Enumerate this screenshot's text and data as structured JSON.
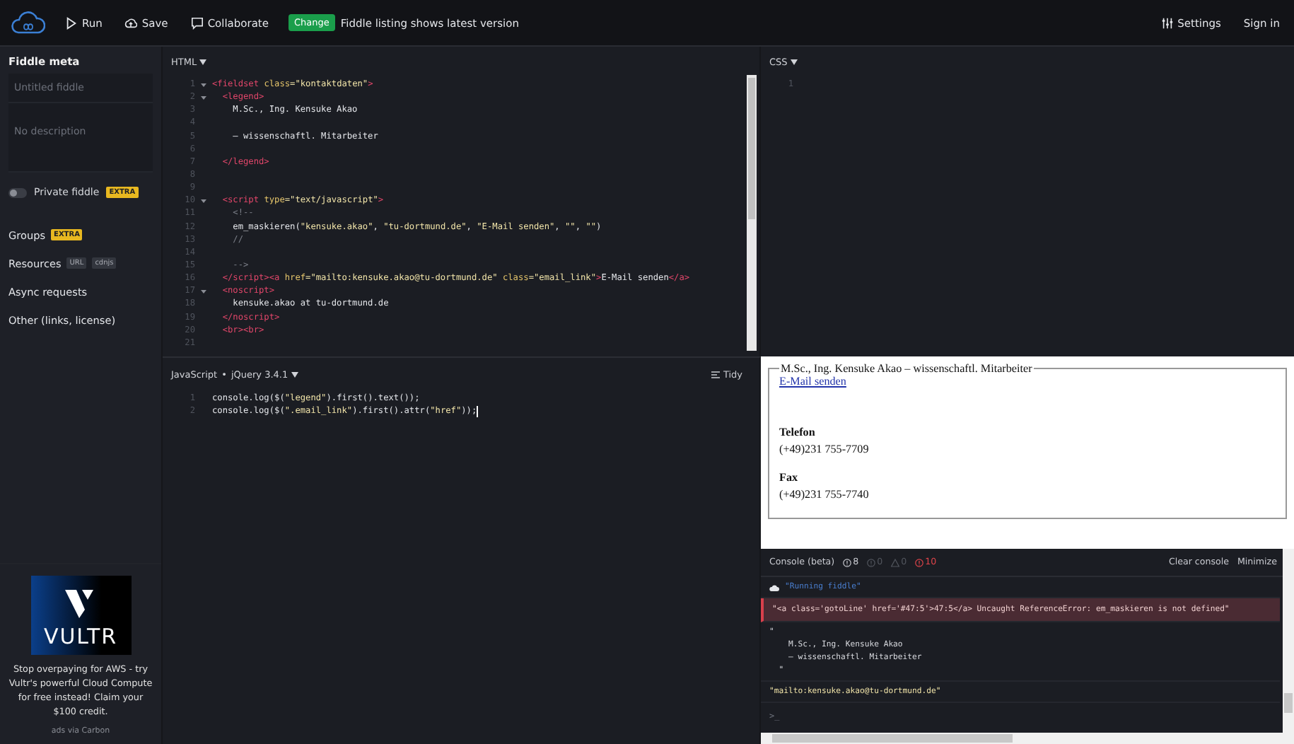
{
  "toolbar": {
    "actions": [
      {
        "label": "Run"
      },
      {
        "label": "Save"
      },
      {
        "label": "Collaborate"
      }
    ],
    "badge": "Change",
    "notice": "Fiddle listing shows latest version",
    "right": [
      {
        "label": "Settings"
      },
      {
        "label": "Sign in"
      }
    ]
  },
  "sidebar": {
    "title": "Fiddle meta",
    "title_field": {
      "placeholder": "Untitled fiddle"
    },
    "description_field": {
      "placeholder": "No description"
    },
    "private_toggle": {
      "label": "Private fiddle",
      "on": false,
      "badge": "EXTRA"
    },
    "items": [
      {
        "label": "Groups",
        "tags": [
          {
            "text": "EXTRA",
            "kind": "extra"
          }
        ]
      },
      {
        "label": "Resources",
        "tags": [
          {
            "text": "URL",
            "kind": "plain"
          },
          {
            "text": "cdnjs",
            "kind": "plain"
          }
        ]
      },
      {
        "label": "Async requests"
      },
      {
        "label": "Other (links, license)"
      }
    ],
    "ad": {
      "logo": "VULTR",
      "text": "Stop overpaying for AWS - try Vultr's powerful Cloud Compute for free instead! Claim your $100 credit.",
      "footer": "ads via Carbon"
    }
  },
  "html_editor": {
    "label": "HTML",
    "lines": [
      {
        "number": "1",
        "fold": true,
        "tokens": [
          {
            "t": "<fieldset",
            "kind": "tag"
          },
          {
            "t": " class",
            "kind": "attr"
          },
          {
            "t": "=\"kontaktdaten\"",
            "kind": "str"
          },
          {
            "t": ">",
            "kind": "tag"
          }
        ]
      },
      {
        "number": "2",
        "fold": true,
        "tokens": [
          {
            "t": "  <legend>",
            "kind": "tag"
          }
        ]
      },
      {
        "number": "3",
        "fold": false,
        "tokens": [
          {
            "t": "    M.Sc., Ing. Kensuke Akao",
            "kind": "text"
          }
        ]
      },
      {
        "number": "4",
        "fold": false
      },
      {
        "number": "5",
        "fold": false,
        "tokens": [
          {
            "t": "    – wissenschaftl. Mitarbeiter",
            "kind": "text"
          }
        ]
      },
      {
        "number": "6",
        "fold": false
      },
      {
        "number": "7",
        "fold": false,
        "tokens": [
          {
            "t": "  </legend>",
            "kind": "tag"
          }
        ]
      },
      {
        "number": "8",
        "fold": false
      },
      {
        "number": "9",
        "fold": false
      },
      {
        "number": "10",
        "fold": true,
        "tokens": [
          {
            "t": "  <script",
            "kind": "tag"
          },
          {
            "t": " type",
            "kind": "attr"
          },
          {
            "t": "=\"text/javascript\"",
            "kind": "str"
          },
          {
            "t": ">",
            "kind": "tag"
          }
        ]
      },
      {
        "number": "11",
        "fold": false,
        "tokens": [
          {
            "t": "    <!--",
            "kind": "comment"
          }
        ]
      },
      {
        "number": "12",
        "fold": false,
        "tokens": [
          {
            "t": "    em_maskieren(",
            "kind": "text"
          },
          {
            "t": "\"kensuke.akao\"",
            "kind": "str"
          },
          {
            "t": ", ",
            "kind": "text"
          },
          {
            "t": "\"tu-dortmund.de\"",
            "kind": "str"
          },
          {
            "t": ", ",
            "kind": "text"
          },
          {
            "t": "\"E-Mail senden\"",
            "kind": "str"
          },
          {
            "t": ", ",
            "kind": "text"
          },
          {
            "t": "\"\"",
            "kind": "str"
          },
          {
            "t": ", ",
            "kind": "text"
          },
          {
            "t": "\"\"",
            "kind": "str"
          },
          {
            "t": ")",
            "kind": "text"
          }
        ]
      },
      {
        "number": "13",
        "fold": false,
        "tokens": [
          {
            "t": "    //",
            "kind": "comment"
          }
        ]
      },
      {
        "number": "14",
        "fold": false
      },
      {
        "number": "15",
        "fold": false,
        "tokens": [
          {
            "t": "    -->",
            "kind": "comment"
          }
        ]
      },
      {
        "number": "16",
        "fold": false,
        "tokens": [
          {
            "t": "  </script><a",
            "kind": "tag"
          },
          {
            "t": " href",
            "kind": "attr"
          },
          {
            "t": "=\"mailto:kensuke.akao@tu-dortmund.de\"",
            "kind": "str"
          },
          {
            "t": " class",
            "kind": "attr"
          },
          {
            "t": "=\"email_link\"",
            "kind": "str"
          },
          {
            "t": ">",
            "kind": "tag"
          },
          {
            "t": "E-Mail senden",
            "kind": "text"
          },
          {
            "t": "</a>",
            "kind": "tag"
          }
        ]
      },
      {
        "number": "17",
        "fold": true,
        "tokens": [
          {
            "t": "  <noscript>",
            "kind": "tag"
          }
        ]
      },
      {
        "number": "18",
        "fold": false,
        "tokens": [
          {
            "t": "    kensuke.akao at tu-dortmund.de",
            "kind": "text"
          }
        ]
      },
      {
        "number": "19",
        "fold": false,
        "tokens": [
          {
            "t": "  </noscript>",
            "kind": "tag"
          }
        ]
      },
      {
        "number": "20",
        "fold": false,
        "tokens": [
          {
            "t": "  <br><br>",
            "kind": "tag"
          }
        ]
      },
      {
        "number": "21",
        "fold": false
      }
    ]
  },
  "css_editor": {
    "label": "CSS",
    "lines": [
      {
        "number": "1",
        "fold": false
      }
    ]
  },
  "js_editor": {
    "label": "JavaScript",
    "separator": "•",
    "framework": "jQuery 3.4.1",
    "tidy": "Tidy",
    "lines": [
      {
        "number": "1",
        "fold": false,
        "tokens": [
          {
            "t": "console.log($(",
            "kind": "text"
          },
          {
            "t": "\"legend\"",
            "kind": "str"
          },
          {
            "t": ").first().text());",
            "kind": "text"
          }
        ]
      },
      {
        "number": "2",
        "fold": false,
        "tokens": [
          {
            "t": "console.log($(",
            "kind": "text"
          },
          {
            "t": "\".email_link\"",
            "kind": "str"
          },
          {
            "t": ").first().attr(",
            "kind": "text"
          },
          {
            "t": "\"href\"",
            "kind": "str"
          },
          {
            "t": "));",
            "kind": "text"
          }
        ]
      }
    ]
  },
  "result": {
    "legend": "M.Sc., Ing. Kensuke Akao – wissenschaftl. Mitarbeiter",
    "link": "E-Mail senden",
    "sections": [
      {
        "heading": "Telefon",
        "value": "(+49)231 755-7709"
      },
      {
        "heading": "Fax",
        "value": "(+49)231 755-7740"
      }
    ]
  },
  "console": {
    "title": "Console (beta)",
    "counters": [
      {
        "kind": "info",
        "count": "8"
      },
      {
        "kind": "log",
        "count": "0"
      },
      {
        "kind": "warn",
        "count": "0"
      },
      {
        "kind": "error",
        "count": "10"
      }
    ],
    "actions": [
      "Clear console",
      "Minimize"
    ],
    "entries": [
      {
        "kind": "info",
        "lines": [
          "\"Running fiddle\""
        ]
      },
      {
        "kind": "error",
        "lines": [
          "\"<a class='gotoLine' href='#47:5'>47:5</a> Uncaught ReferenceError: em_maskieren is not defined\""
        ]
      },
      {
        "kind": "log",
        "lines": [
          "\"",
          "    M.Sc., Ing. Kensuke Akao",
          "    – wissenschaftl. Mitarbeiter",
          "  \""
        ]
      },
      {
        "kind": "log",
        "lines": [
          "\"mailto:kensuke.akao@tu-dortmund.de\""
        ]
      }
    ],
    "prompt": ">_"
  }
}
